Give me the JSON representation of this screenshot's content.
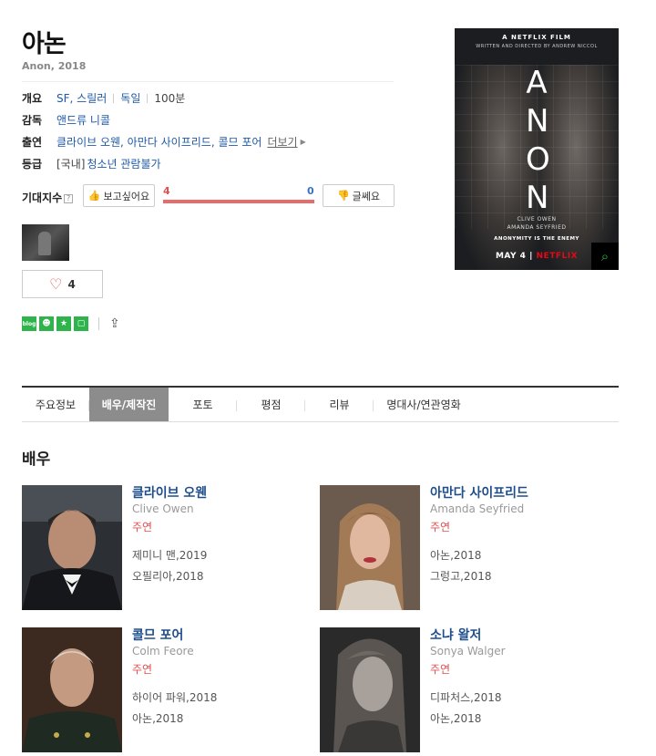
{
  "movie": {
    "title": "아논",
    "subtitle": "Anon, 2018"
  },
  "info": {
    "overview_label": "개요",
    "genre": "SF, 스릴러",
    "country": "독일",
    "runtime": "100분",
    "director_label": "감독",
    "director": "앤드류 니콜",
    "cast_label": "출연",
    "cast": "클라이브 오웬, 아만다 사이프리드, 콜므 포어",
    "cast_more": "더보기",
    "rating_label": "등급",
    "rating_prefix": "[국내]",
    "rating": "청소년 관람불가"
  },
  "expectation": {
    "label": "기대지수",
    "help": "?",
    "like_label": "보고싶어요",
    "hate_label": "글쎄요",
    "like_count": "4",
    "hate_count": "0",
    "like_ratio": 1.0
  },
  "likes": {
    "count": "4"
  },
  "share": {
    "icons": [
      "blog-icon",
      "cafe-icon",
      "bookmark-icon",
      "memo-icon"
    ],
    "labels": [
      "blog",
      "☻",
      "★",
      "▢"
    ],
    "accent": "#2fb44b"
  },
  "poster": {
    "netflix_film": "A NETFLIX FILM",
    "directed_by": "WRITTEN AND DIRECTED BY ANDREW NICCOL",
    "letters": [
      "A",
      "N",
      "O",
      "N"
    ],
    "cast1": "CLIVE OWEN",
    "cast2": "AMANDA SEYFRIED",
    "tagline": "ANONYMITY IS THE ENEMY",
    "date": "MAY 4",
    "brand": "NETFLIX"
  },
  "tabs": [
    {
      "label": "주요정보"
    },
    {
      "label": "배우/제작진"
    },
    {
      "label": "포토"
    },
    {
      "label": "평점"
    },
    {
      "label": "리뷰"
    },
    {
      "label": "명대사/연관영화"
    }
  ],
  "actors_section": {
    "title": "배우",
    "actors": [
      {
        "name": "클라이브 오웬",
        "name_en": "Clive Owen",
        "role": "주연",
        "works": [
          "제미니 맨,2019",
          "오필리아,2018"
        ]
      },
      {
        "name": "아만다 사이프리드",
        "name_en": "Amanda Seyfried",
        "role": "주연",
        "works": [
          "아논,2018",
          "그렁고,2018"
        ]
      },
      {
        "name": "콜므 포어",
        "name_en": "Colm Feore",
        "role": "주연",
        "works": [
          "하이어 파워,2018",
          "아논,2018"
        ]
      },
      {
        "name": "소냐 왈저",
        "name_en": "Sonya Walger",
        "role": "주연",
        "works": [
          "디파처스,2018",
          "아논,2018"
        ]
      }
    ]
  }
}
